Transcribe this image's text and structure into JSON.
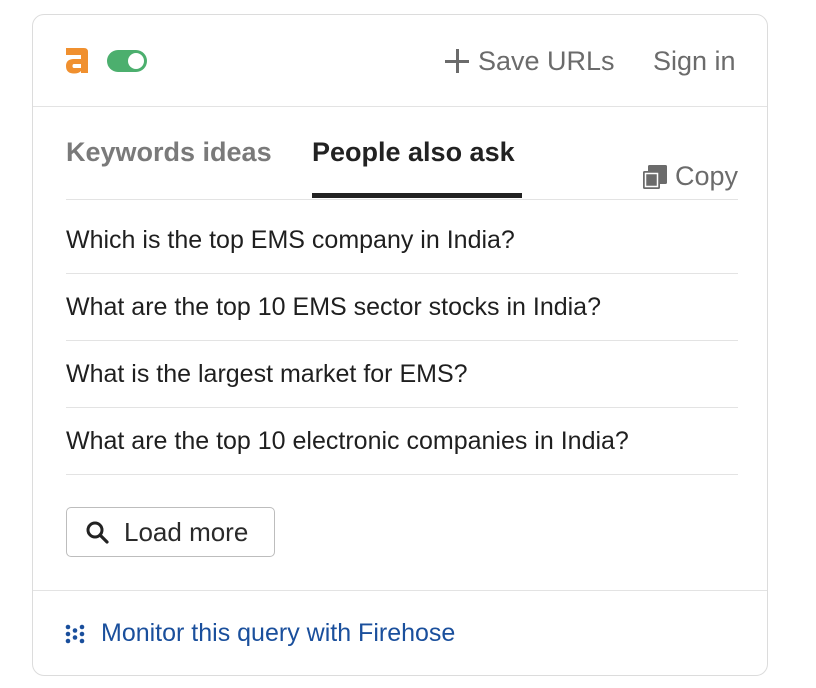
{
  "header": {
    "logo_icon": "ahrefs-a-logo-icon",
    "logo_color": "#f0902f",
    "toggle_state": "on",
    "toggle_color": "#4caf6e",
    "save_urls_label": "Save URLs",
    "sign_in_label": "Sign in"
  },
  "tabs": [
    {
      "label": "Keywords ideas",
      "active": false
    },
    {
      "label": "People also ask",
      "active": true
    }
  ],
  "copy_label": "Copy",
  "questions": [
    "Which is the top EMS company in India?",
    "What are the top 10 EMS sector stocks in India?",
    "What is the largest market for EMS?",
    "What are the top 10 electronic companies in India?"
  ],
  "load_more_label": "Load more",
  "footer": {
    "firehose_label": "Monitor this query with Firehose",
    "link_color": "#1a4f9c"
  }
}
